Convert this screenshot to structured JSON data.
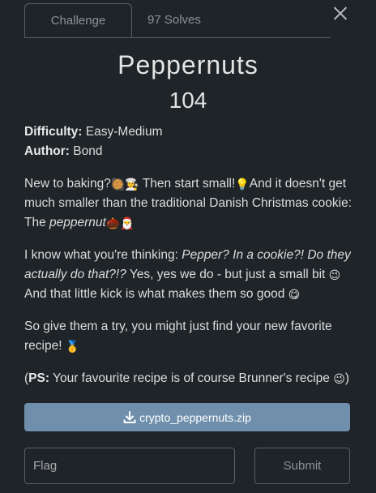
{
  "tabs": {
    "challenge": "Challenge",
    "solves": "97 Solves"
  },
  "challenge": {
    "name": "Peppernuts",
    "points": "104",
    "difficulty_label": "Difficulty:",
    "difficulty_value": "Easy-Medium",
    "author_label": "Author:",
    "author_value": "Bond",
    "p1_a": "New to baking?",
    "p1_b": "Then start small!",
    "p1_c": "And it doesn't get much smaller than the traditional Danish Christmas cookie: The ",
    "p1_italic": "peppernut",
    "p2_a": "I know what you're thinking: ",
    "p2_italic": "Pepper? In a cookie?! Do they actually do that?!?",
    "p2_b": " Yes, yes we do - but just a small bit ",
    "p2_c": " And that little kick is what makes them so good ",
    "p3_a": "So give them a try, you might just find your new favorite recipe! ",
    "p4_open": "(",
    "p4_label": "PS:",
    "p4_text": " Your favourite recipe is of course Brunner's recipe ",
    "p4_close": ")",
    "emoji": {
      "pan": "🥘",
      "cook": "👩‍🍳",
      "bulb": "💡",
      "chestnut": "🌰",
      "santa": "🎅",
      "wink": "😉",
      "yum": "😋",
      "medal": "🥇"
    }
  },
  "file": {
    "name": "crypto_peppernuts.zip",
    "icon": "download-icon"
  },
  "flag": {
    "placeholder": "Flag",
    "value": ""
  },
  "submit_label": "Submit"
}
